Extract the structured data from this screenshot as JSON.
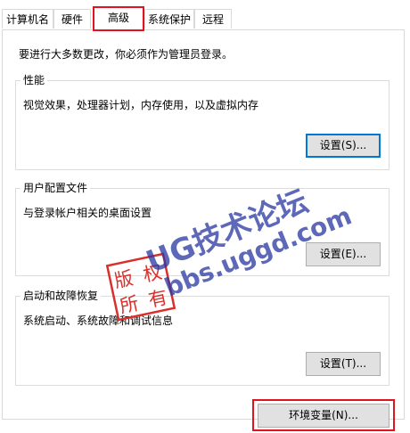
{
  "tabs": [
    {
      "label": "计算机名"
    },
    {
      "label": "硬件"
    },
    {
      "label": "高级"
    },
    {
      "label": "系统保护"
    },
    {
      "label": "远程"
    }
  ],
  "active_tab": "高级",
  "notice": "要进行大多数更改，你必须作为管理员登录。",
  "performance": {
    "title": "性能",
    "description": "视觉效果，处理器计划，内存使用，以及虚拟内存",
    "button": "设置(S)..."
  },
  "user_profiles": {
    "title": "用户配置文件",
    "description": "与登录帐户相关的桌面设置",
    "button": "设置(E)..."
  },
  "startup_recovery": {
    "title": "启动和故障恢复",
    "description": "系统启动、系统故障和调试信息",
    "button": "设置(T)..."
  },
  "env_button": "环境变量(N)...",
  "watermark": {
    "line1": "UG技术论坛",
    "line2": "bbs.uggd.com",
    "seal": [
      "版",
      "权",
      "所",
      "有"
    ],
    "seal_color": "#d9302c",
    "text_color": "#2a3aa6"
  },
  "colors": {
    "highlight_outline": "#e0141c",
    "focus_border": "#0078d7",
    "button_face": "#e1e1e1"
  }
}
